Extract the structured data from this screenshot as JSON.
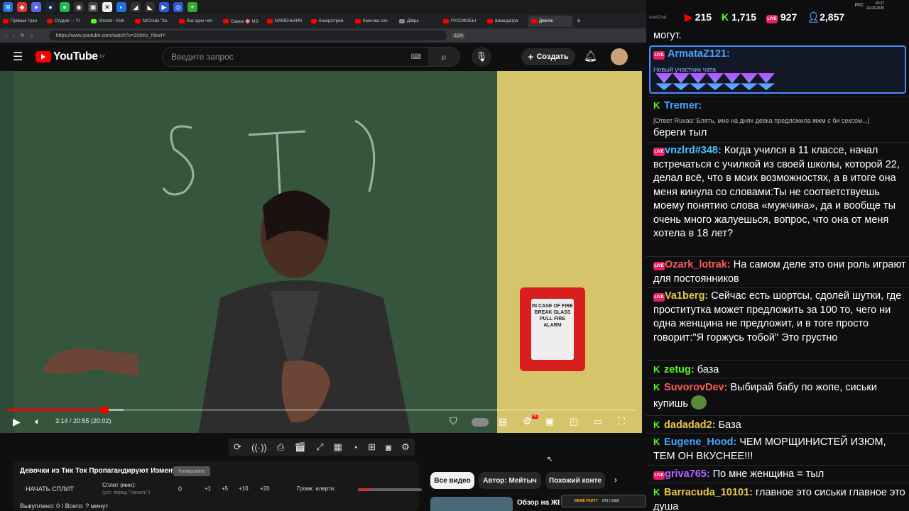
{
  "taskbar": {
    "clock_time": "16:27",
    "clock_date": "21.09.2025",
    "lang": "РУС"
  },
  "browser": {
    "tabs": [
      "Прямые тран",
      "Студия — YI",
      "Stream - Kick",
      "MrCredo \"За",
      "Как один чел",
      "Самое 🎯 МЭ",
      "МАМЕНЬКИН",
      "Кикер/стрим",
      "Каннова сле",
      "Дівіра",
      "РУСОФОБЫ",
      "Шмандатра",
      "Девочк"
    ],
    "url": "https://www.youtube.com/watch?v=3XbKc_NkwIY",
    "ext_badge": "124"
  },
  "youtube": {
    "logo_text": "YouTube",
    "logo_region": "LV",
    "search_placeholder": "Введите запрос",
    "create_label": "Создать",
    "player": {
      "time": "3:14 / 20:55 (20:02)",
      "progress_fraction": 0.155,
      "buffered_fraction": 0.185,
      "alarm_text": "IN CASE OF FIRE BREAK GLASS PULL FIRE ALARM",
      "hd_badge": "HD"
    },
    "split_panel": {
      "video_title": "Девочки из Тик Ток Пропагандируют Измену",
      "copy_label": "Копировать",
      "start_split": "НАЧАТЬ СПЛИТ",
      "split_label": "Сплит (мин):",
      "split_hint": "(уст. перед \"Начать\")",
      "split_value": "0",
      "increments": [
        "+1",
        "+5",
        "+10",
        "+20"
      ],
      "alert_volume_label": "Громк. алерта:",
      "alert_volume_fraction": 0.2,
      "bought_label": "Выкуплено: 0 / Всего: ? минут"
    },
    "chips": [
      "Все видео",
      "Автор: Мейтыч",
      "Похожий конте"
    ],
    "rec_title": "Обзор на ЖЕ"
  },
  "chat": {
    "app_label": "AxelChat",
    "stats": {
      "youtube_viewers": "215",
      "kick_viewers": "1,715",
      "live_viewers": "927",
      "total_viewers": "2,857"
    },
    "top_fragment": "могут.",
    "messages": [
      {
        "platform": "live",
        "user": "ArmataZ121:",
        "color": "#4aa3ff",
        "note": "Новый участник чата",
        "text": ""
      },
      {
        "platform": "kick",
        "user": "Tremer:",
        "color": "#4aa3ff",
        "reply": "[Ответ Ruvaa: Блять, мне на днях девка предложила мжм с би сексом...]",
        "text": "береги тыл"
      },
      {
        "platform": "live",
        "user": "vnzlrd#348:",
        "color": "#49c2ff",
        "text": "Когда учился в 11 классе, начал встречаться с училкой из своей школы, которой 22, делал всё, что в моих возможностях, а в итоге она меня кинула со словами:Ты не соответствуешь моему понятию слова «мужчина», да и вообще ты очень много жалуешься, вопрос, что она от меня хотела в 18 лет?"
      },
      {
        "platform": "live",
        "user": "Ozark_lotrak:",
        "color": "#ff5a5a",
        "text": "На самом деле это они роль играют для постоянников"
      },
      {
        "platform": "live",
        "user": "Va1berg:",
        "color": "#e8c84a",
        "text": "Сейчас есть шортсы, сдолей шутки, где проститутка может предложить за 100 то, чего ни одна женщина не предложит, и в тоге просто говорит:\"Я горжусь тобой\" Это грустно"
      },
      {
        "platform": "kick",
        "user": "zetug:",
        "color": "#53fc18",
        "text": "база"
      },
      {
        "platform": "kick",
        "user": "SuvorovDev:",
        "color": "#ff5a5a",
        "text": "Выбирай бабу по жопе, сиськи купишь"
      },
      {
        "platform": "kick",
        "user": "dadadad2:",
        "color": "#e8c84a",
        "text": "База"
      },
      {
        "platform": "kick",
        "user": "Eugene_Hood:",
        "color": "#4aa3ff",
        "text": "ЧЕМ МОРЩИНИСТЕЙ ИЗЮМ, ТЕМ ОН ВКУСНЕЕ!!!"
      },
      {
        "platform": "live",
        "user": "griva765:",
        "color": "#b36bff",
        "text": "По мне женщина = тыл"
      },
      {
        "platform": "kick",
        "user": "Barracuda_10101:",
        "color": "#e8c84a",
        "text": "главное это сиськи главное это душа"
      }
    ],
    "meme_party": {
      "label": "MEME PARTY",
      "progress": "675 / 1500"
    }
  }
}
